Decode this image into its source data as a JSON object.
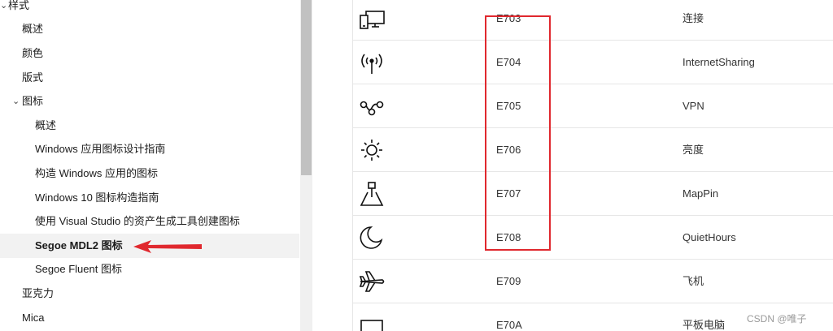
{
  "sidebar": {
    "items": [
      {
        "label": "样式",
        "level": 0,
        "expanded": true
      },
      {
        "label": "概述",
        "level": 1
      },
      {
        "label": "颜色",
        "level": 1
      },
      {
        "label": "版式",
        "level": 1
      },
      {
        "label": "图标",
        "level": 1,
        "expanded": true
      },
      {
        "label": "概述",
        "level": 2
      },
      {
        "label": "Windows 应用图标设计指南",
        "level": 2
      },
      {
        "label": "构造 Windows 应用的图标",
        "level": 2
      },
      {
        "label": "Windows 10 图标构造指南",
        "level": 2
      },
      {
        "label": "使用 Visual Studio 的资产生成工具创建图标",
        "level": 2
      },
      {
        "label": "Segoe MDL2 图标",
        "level": 2,
        "selected": true
      },
      {
        "label": "Segoe Fluent 图标",
        "level": 2
      },
      {
        "label": "亚克力",
        "level": 1
      },
      {
        "label": "Mica",
        "level": 1
      }
    ]
  },
  "icons_table": {
    "rows": [
      {
        "icon": "connect-devices-icon",
        "code": "E703",
        "description": "连接"
      },
      {
        "icon": "internet-sharing-icon",
        "code": "E704",
        "description": "InternetSharing"
      },
      {
        "icon": "vpn-icon",
        "code": "E705",
        "description": "VPN"
      },
      {
        "icon": "brightness-icon",
        "code": "E706",
        "description": "亮度"
      },
      {
        "icon": "map-pin-icon",
        "code": "E707",
        "description": "MapPin"
      },
      {
        "icon": "quiet-hours-icon",
        "code": "E708",
        "description": "QuietHours"
      },
      {
        "icon": "airplane-icon",
        "code": "E709",
        "description": "飞机"
      },
      {
        "icon": "tablet-icon",
        "code": "E70A",
        "description": "平板电脑"
      }
    ]
  },
  "annotation": {
    "color": "#e0282e"
  },
  "watermark": {
    "text": "CSDN @唯子"
  }
}
